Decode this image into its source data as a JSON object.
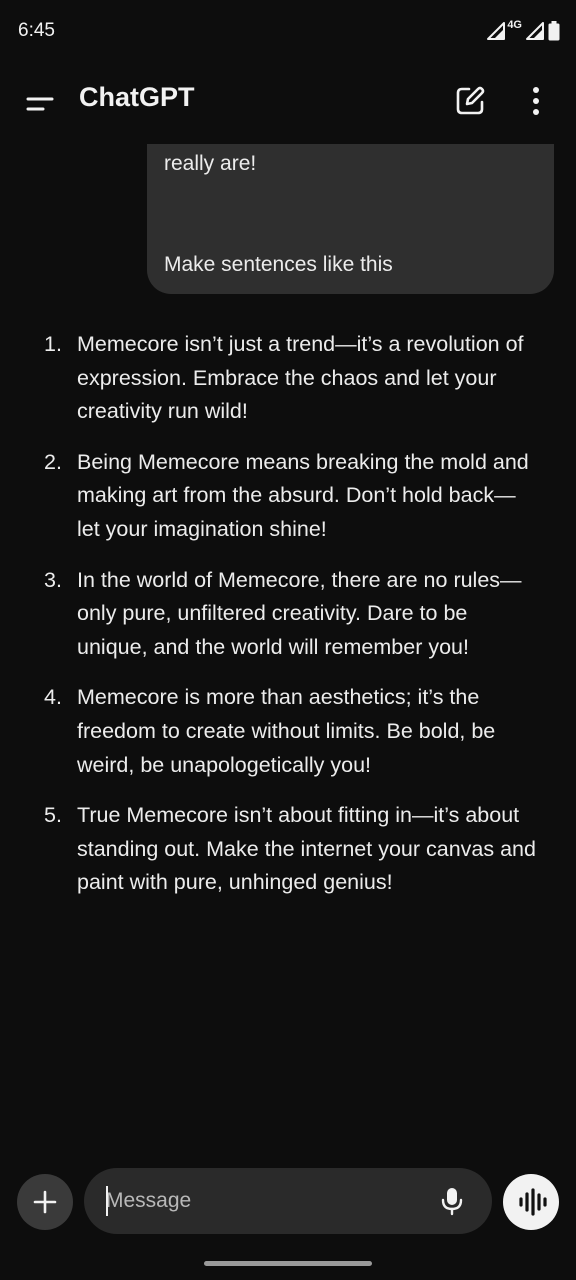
{
  "status_bar": {
    "time": "6:45",
    "network_label": "4G",
    "icons": [
      "signal-icon",
      "signal-icon",
      "battery-icon"
    ]
  },
  "app_bar": {
    "title": "ChatGPT",
    "icons": [
      "menu-icon",
      "new-chat-icon",
      "more-vertical-icon"
    ]
  },
  "conversation": {
    "user_message": {
      "visible_lines": [
        "really are!",
        "Make sentences like this"
      ]
    },
    "assistant_reply": {
      "items": [
        {
          "number": "1.",
          "text": "Memecore isn’t just a trend—it’s a revolution of expression. Embrace the chaos and let your creativity run wild!"
        },
        {
          "number": "2.",
          "text": "Being Memecore means breaking the mold and making art from the absurd. Don’t hold back—let your imagination shine!"
        },
        {
          "number": "3.",
          "text": "In the world of Memecore, there are no rules—only pure, unfiltered creativity. Dare to be unique, and the world will remember you!"
        },
        {
          "number": "4.",
          "text": "Memecore is more than aesthetics; it’s the freedom to create without limits. Be bold, be weird, be unapologetically you!"
        },
        {
          "number": "5.",
          "text": "True Memecore isn’t about fitting in—it’s about standing out. Make the internet your canvas and paint with pure, unhinged genius!"
        }
      ]
    }
  },
  "composer": {
    "placeholder": "Message",
    "value": "",
    "icons": [
      "plus-icon",
      "microphone-icon",
      "voice-mode-icon"
    ]
  },
  "colors": {
    "background": "#0d0d0d",
    "user_bubble": "#2f2f2f",
    "input_field": "#2a2a2a",
    "text": "#ececec"
  }
}
